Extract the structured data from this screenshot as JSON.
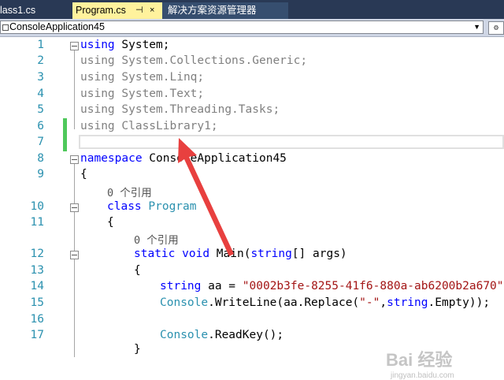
{
  "tabs": [
    {
      "label": "lass1.cs"
    },
    {
      "label": "Program.cs",
      "pin": "⊣",
      "close": "×"
    },
    {
      "label": "解决方案资源管理器"
    }
  ],
  "nav": {
    "project": "ConsoleApplication45",
    "arrow": "▼",
    "right_icon": "⚙"
  },
  "line_numbers": [
    "1",
    "2",
    "3",
    "4",
    "5",
    "6",
    "7",
    "8",
    "9",
    "10",
    "11",
    "12",
    "13",
    "14",
    "15",
    "16",
    "17"
  ],
  "code": {
    "l1": {
      "kw": "using",
      "rest": " System;"
    },
    "l2": {
      "kw": "using",
      "rest": " System.Collections.Generic;"
    },
    "l3": {
      "kw": "using",
      "rest": " System.Linq;"
    },
    "l4": {
      "kw": "using",
      "rest": " System.Text;"
    },
    "l5": {
      "kw": "using",
      "rest": " System.Threading.Tasks;"
    },
    "l6": {
      "kw": "using",
      "rest": " ClassLibrary1;"
    },
    "l8": {
      "kw": "namespace",
      "rest": " ConsoleApplication45"
    },
    "l9": "{",
    "lens1": "0 个引用",
    "l10": {
      "kw": "class",
      "typ": "Program"
    },
    "l11": "{",
    "lens2": "0 个引用",
    "l12": {
      "kw1": "static",
      "kw2": "void",
      "name": "Main(",
      "kw3": "string",
      "rest": "[] args)"
    },
    "l13": "{",
    "l14": {
      "kw": "string",
      "rest": " aa = ",
      "str": "\"0002b3fe-8255-41f6-880a-ab6200b2a670\"",
      "end": ";"
    },
    "l15": {
      "typ": "Console",
      "a": ".WriteLine(aa.Replace(",
      "str": "\"-\"",
      "b": ",",
      "kw": "string",
      "c": ".Empty));"
    },
    "l17": {
      "typ": "Console",
      "a": ".ReadKey();"
    },
    "l18": "}"
  },
  "watermark": {
    "main": "Bai 经验",
    "sub": "jingyan.baidu.com"
  },
  "colors": {
    "arrow": "#e8403f",
    "changebar": "#4fc85b",
    "line_number": "#2b91af",
    "keyword": "#0000ff",
    "type": "#2b91af",
    "string": "#a31515"
  }
}
